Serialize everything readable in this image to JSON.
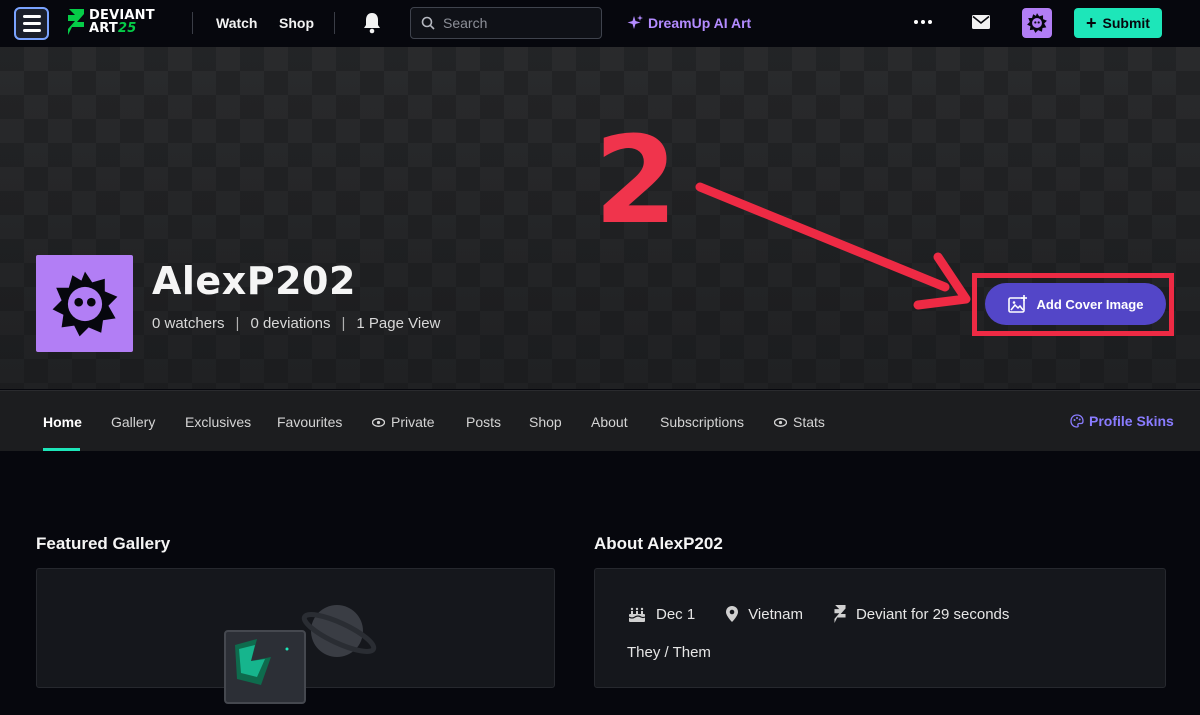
{
  "topbar": {
    "logo_top": "DEVIANT",
    "logo_bottom": "ART",
    "logo_anniv": "25",
    "nav": [
      "Watch",
      "Shop"
    ],
    "search_placeholder": "Search",
    "dreamup_label": "DreamUp AI Art",
    "submit_label": "Submit",
    "accent": "#1de6b9",
    "dreamup_color": "#b38bff"
  },
  "profile": {
    "username": "AlexP202",
    "watchers": "0 watchers",
    "deviations": "0 deviations",
    "page_views": "1 Page View",
    "separator": "|",
    "avatar_color": "#b27ef5",
    "add_cover_label": "Add Cover Image",
    "cover_button_color": "#5346c8"
  },
  "annotation": {
    "number": "2",
    "color": "#ee2a44"
  },
  "tabs": {
    "items": [
      "Home",
      "Gallery",
      "Exclusives",
      "Favourites",
      "Private",
      "Posts",
      "Shop",
      "About",
      "Subscriptions",
      "Stats"
    ],
    "active": "Home",
    "profile_skins": "Profile Skins"
  },
  "featured": {
    "title": "Featured Gallery"
  },
  "about": {
    "title": "About AlexP202",
    "birthday": "Dec 1",
    "location": "Vietnam",
    "deviant_for": "Deviant for 29 seconds",
    "pronouns": "They / Them"
  }
}
